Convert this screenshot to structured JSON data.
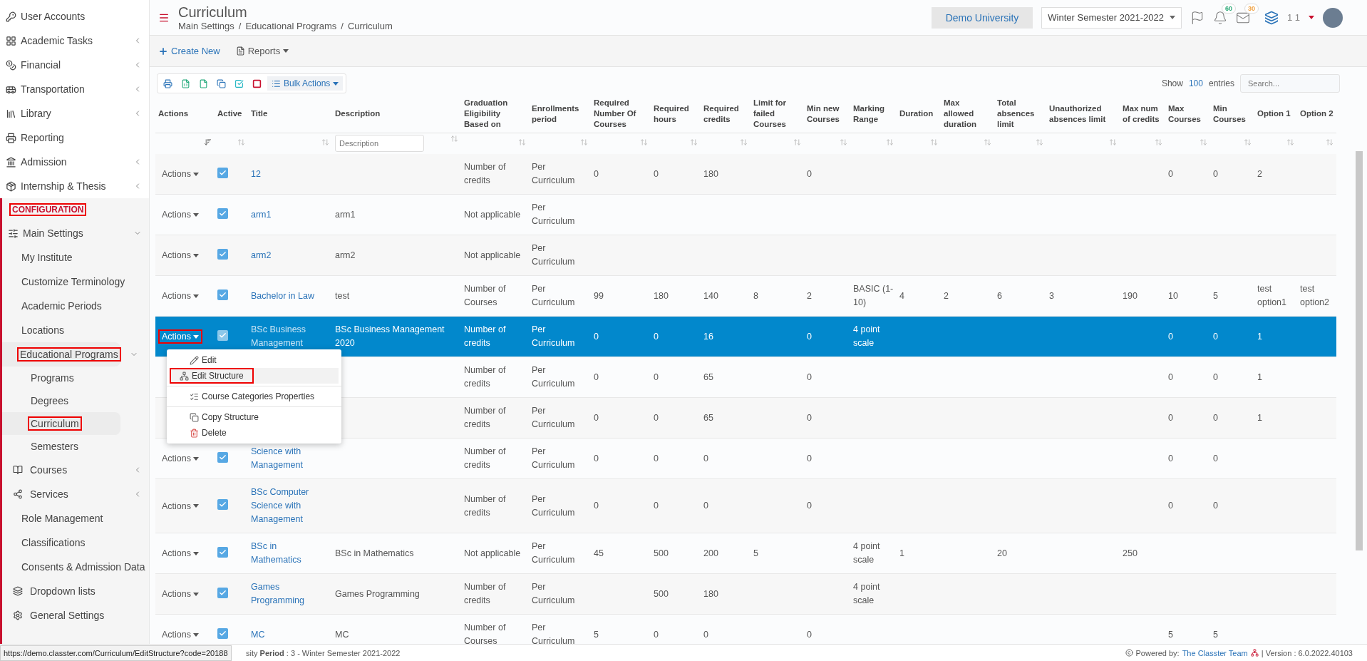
{
  "sidebar": {
    "items": [
      {
        "label": "User Accounts",
        "expandable": false
      },
      {
        "label": "Academic Tasks",
        "expandable": true
      },
      {
        "label": "Financial",
        "expandable": true
      },
      {
        "label": "Transportation",
        "expandable": true
      },
      {
        "label": "Library",
        "expandable": true
      },
      {
        "label": "Reporting",
        "expandable": false
      },
      {
        "label": "Admission",
        "expandable": true
      },
      {
        "label": "Internship & Thesis",
        "expandable": true
      }
    ],
    "section": {
      "label": "CONFIGURATION",
      "highlighted": true
    },
    "config": [
      {
        "label": "Main Settings",
        "expanded": true,
        "children": [
          {
            "label": "My Institute"
          },
          {
            "label": "Customize Terminology"
          },
          {
            "label": "Academic Periods"
          },
          {
            "label": "Locations"
          },
          {
            "label": "Educational Programs",
            "expanded": true,
            "highlighted": true,
            "children": [
              {
                "label": "Programs",
                "selected": false,
                "highlighted": false
              },
              {
                "label": "Degrees",
                "selected": false,
                "highlighted": false
              },
              {
                "label": "Curriculum",
                "selected": true,
                "highlighted": true
              },
              {
                "label": "Semesters",
                "selected": false,
                "highlighted": false
              }
            ]
          },
          {
            "label": "Courses",
            "expanded": false
          },
          {
            "label": "Services",
            "expanded": false
          },
          {
            "label": "Role Management"
          },
          {
            "label": "Classifications"
          },
          {
            "label": "Consents & Admission Data"
          },
          {
            "label": "Dropdown lists"
          },
          {
            "label": "General Settings"
          }
        ]
      }
    ]
  },
  "header": {
    "title": "Curriculum",
    "breadcrumbs": [
      {
        "label": "Main Settings",
        "separator": "/"
      },
      {
        "label": "Educational Programs",
        "separator": "/"
      },
      {
        "label": "Curriculum"
      }
    ],
    "institution": "Demo University",
    "semester": "Winter Semester 2021-2022",
    "notifications": "60",
    "messages": "30",
    "user": "1 1"
  },
  "toolbar": {
    "create": "Create New",
    "reports": "Reports"
  },
  "table_tools": {
    "bulk": "Bulk Actions",
    "show": "Show",
    "page_size": "100",
    "entries": "entries",
    "search": {
      "placeholder": "Search..."
    }
  },
  "table": {
    "columns": [
      {
        "label": "Actions",
        "sorted": true
      },
      {
        "label": "Active",
        "sorted": false
      },
      {
        "label": "Title",
        "sorted": false
      },
      {
        "label": "Description",
        "sorted": false,
        "placeholder": "Description"
      },
      {
        "label": "Graduation Eligibility Based on",
        "sorted": false
      },
      {
        "label": "Enrollments period",
        "sorted": false
      },
      {
        "label": "Required Number Of Courses",
        "sorted": false
      },
      {
        "label": "Required hours",
        "sorted": false
      },
      {
        "label": "Required credits",
        "sorted": false
      },
      {
        "label": "Limit for failed Courses",
        "sorted": false
      },
      {
        "label": "Min new Courses",
        "sorted": false
      },
      {
        "label": "Marking Range",
        "sorted": false
      },
      {
        "label": "Duration",
        "sorted": false
      },
      {
        "label": "Max allowed duration",
        "sorted": false
      },
      {
        "label": "Total absences limit",
        "sorted": false
      },
      {
        "label": "Unauthorized absences limit",
        "sorted": false
      },
      {
        "label": "Max num of credits",
        "sorted": false
      },
      {
        "label": "Max Courses",
        "sorted": false
      },
      {
        "label": "Min Courses",
        "sorted": false
      },
      {
        "label": "Option 1",
        "sorted": false
      },
      {
        "label": "Option 2",
        "sorted": false
      }
    ],
    "rows": [
      {
        "selected": false,
        "active": true,
        "cells": [
          "Actions",
          "",
          "12",
          "",
          "Number of credits",
          "Per Curriculum",
          "0",
          "0",
          "180",
          "",
          "0",
          "",
          "",
          "",
          "",
          "",
          "",
          "0",
          "0",
          "2",
          ""
        ]
      },
      {
        "selected": false,
        "active": true,
        "cells": [
          "Actions",
          "",
          "arm1",
          "arm1",
          "Not applicable",
          "Per Curriculum",
          "",
          "",
          "",
          "",
          "",
          "",
          "",
          "",
          "",
          "",
          "",
          "",
          "",
          "",
          ""
        ]
      },
      {
        "selected": false,
        "active": true,
        "cells": [
          "Actions",
          "",
          "arm2",
          "arm2",
          "Not applicable",
          "Per Curriculum",
          "",
          "",
          "",
          "",
          "",
          "",
          "",
          "",
          "",
          "",
          "",
          "",
          "",
          "",
          ""
        ]
      },
      {
        "selected": false,
        "active": true,
        "cells": [
          "Actions",
          "",
          "Bachelor in Law",
          "test",
          "Number of Courses",
          "Per Curriculum",
          "99",
          "180",
          "140",
          "8",
          "2",
          "BASIC (1-10)",
          "4",
          "2",
          "6",
          "3",
          "190",
          "10",
          "5",
          "test option1",
          "test option2"
        ]
      },
      {
        "selected": true,
        "actions_highlighted": true,
        "active": true,
        "cells": [
          "Actions",
          "",
          "BSc Business Management",
          "BSc Business Management 2020",
          "Number of credits",
          "Per Curriculum",
          "0",
          "0",
          "16",
          "",
          "0",
          "4 point scale",
          "",
          "",
          "",
          "",
          "",
          "0",
          "0",
          "1",
          ""
        ]
      },
      {
        "selected": false,
        "cells": [
          "",
          "",
          "",
          "",
          "Number of credits",
          "Per Curriculum",
          "0",
          "0",
          "65",
          "",
          "0",
          "",
          "",
          "",
          "",
          "",
          "",
          "0",
          "0",
          "1",
          ""
        ]
      },
      {
        "selected": false,
        "cells": [
          "",
          "",
          "",
          "",
          "Number of credits",
          "Per Curriculum",
          "0",
          "0",
          "65",
          "",
          "0",
          "",
          "",
          "",
          "",
          "",
          "",
          "0",
          "0",
          "1",
          ""
        ]
      },
      {
        "selected": false,
        "active": true,
        "cells": [
          "Actions",
          "",
          "Science with Management",
          "",
          "Number of credits",
          "Per Curriculum",
          "0",
          "0",
          "0",
          "",
          "0",
          "",
          "",
          "",
          "",
          "",
          "",
          "0",
          "0",
          "",
          ""
        ]
      },
      {
        "selected": false,
        "active": true,
        "cells": [
          "Actions",
          "",
          "BSc Computer Science with Management",
          "",
          "Number of credits",
          "Per Curriculum",
          "0",
          "0",
          "0",
          "",
          "0",
          "",
          "",
          "",
          "",
          "",
          "",
          "0",
          "0",
          "",
          ""
        ]
      },
      {
        "selected": false,
        "active": true,
        "cells": [
          "Actions",
          "",
          "BSc in Mathematics",
          "BSc in Mathematics",
          "Not applicable",
          "Per Curriculum",
          "45",
          "500",
          "200",
          "5",
          "",
          "4 point scale",
          "1",
          "",
          "20",
          "",
          "250",
          "",
          "",
          "",
          ""
        ]
      },
      {
        "selected": false,
        "active": true,
        "cells": [
          "Actions",
          "",
          "Games Programming",
          "Games Programming",
          "Number of credits",
          "Per Curriculum",
          "",
          "500",
          "180",
          "",
          "",
          "4 point scale",
          "",
          "",
          "",
          "",
          "",
          "",
          "",
          "",
          ""
        ]
      },
      {
        "selected": false,
        "active": true,
        "cells": [
          "Actions",
          "",
          "MC",
          "MC",
          "Number of Courses",
          "Per Curriculum",
          "5",
          "0",
          "0",
          "",
          "0",
          "",
          "",
          "",
          "",
          "",
          "",
          "5",
          "5",
          "",
          ""
        ]
      }
    ]
  },
  "menu": {
    "groups": [
      [
        {
          "label": "Edit",
          "selected": false,
          "highlighted": false
        },
        {
          "label": "Edit Structure",
          "selected": true,
          "highlighted": true
        }
      ],
      [
        {
          "label": "Course Categories Properties",
          "selected": false,
          "highlighted": false
        }
      ],
      [
        {
          "label": "Copy Structure",
          "selected": false,
          "highlighted": false
        },
        {
          "label": "Delete",
          "selected": false,
          "highlighted": false
        }
      ]
    ]
  },
  "status_bar": {
    "url": "https://demo.classter.com/Curriculum/EditStructure?code=20188",
    "period": "sity **Period** : 3 - Winter Semester 2021-2022",
    "powered": "Powered by:",
    "team": "The Classter Team",
    "version": "| Version : 6.0.2022.40103"
  }
}
